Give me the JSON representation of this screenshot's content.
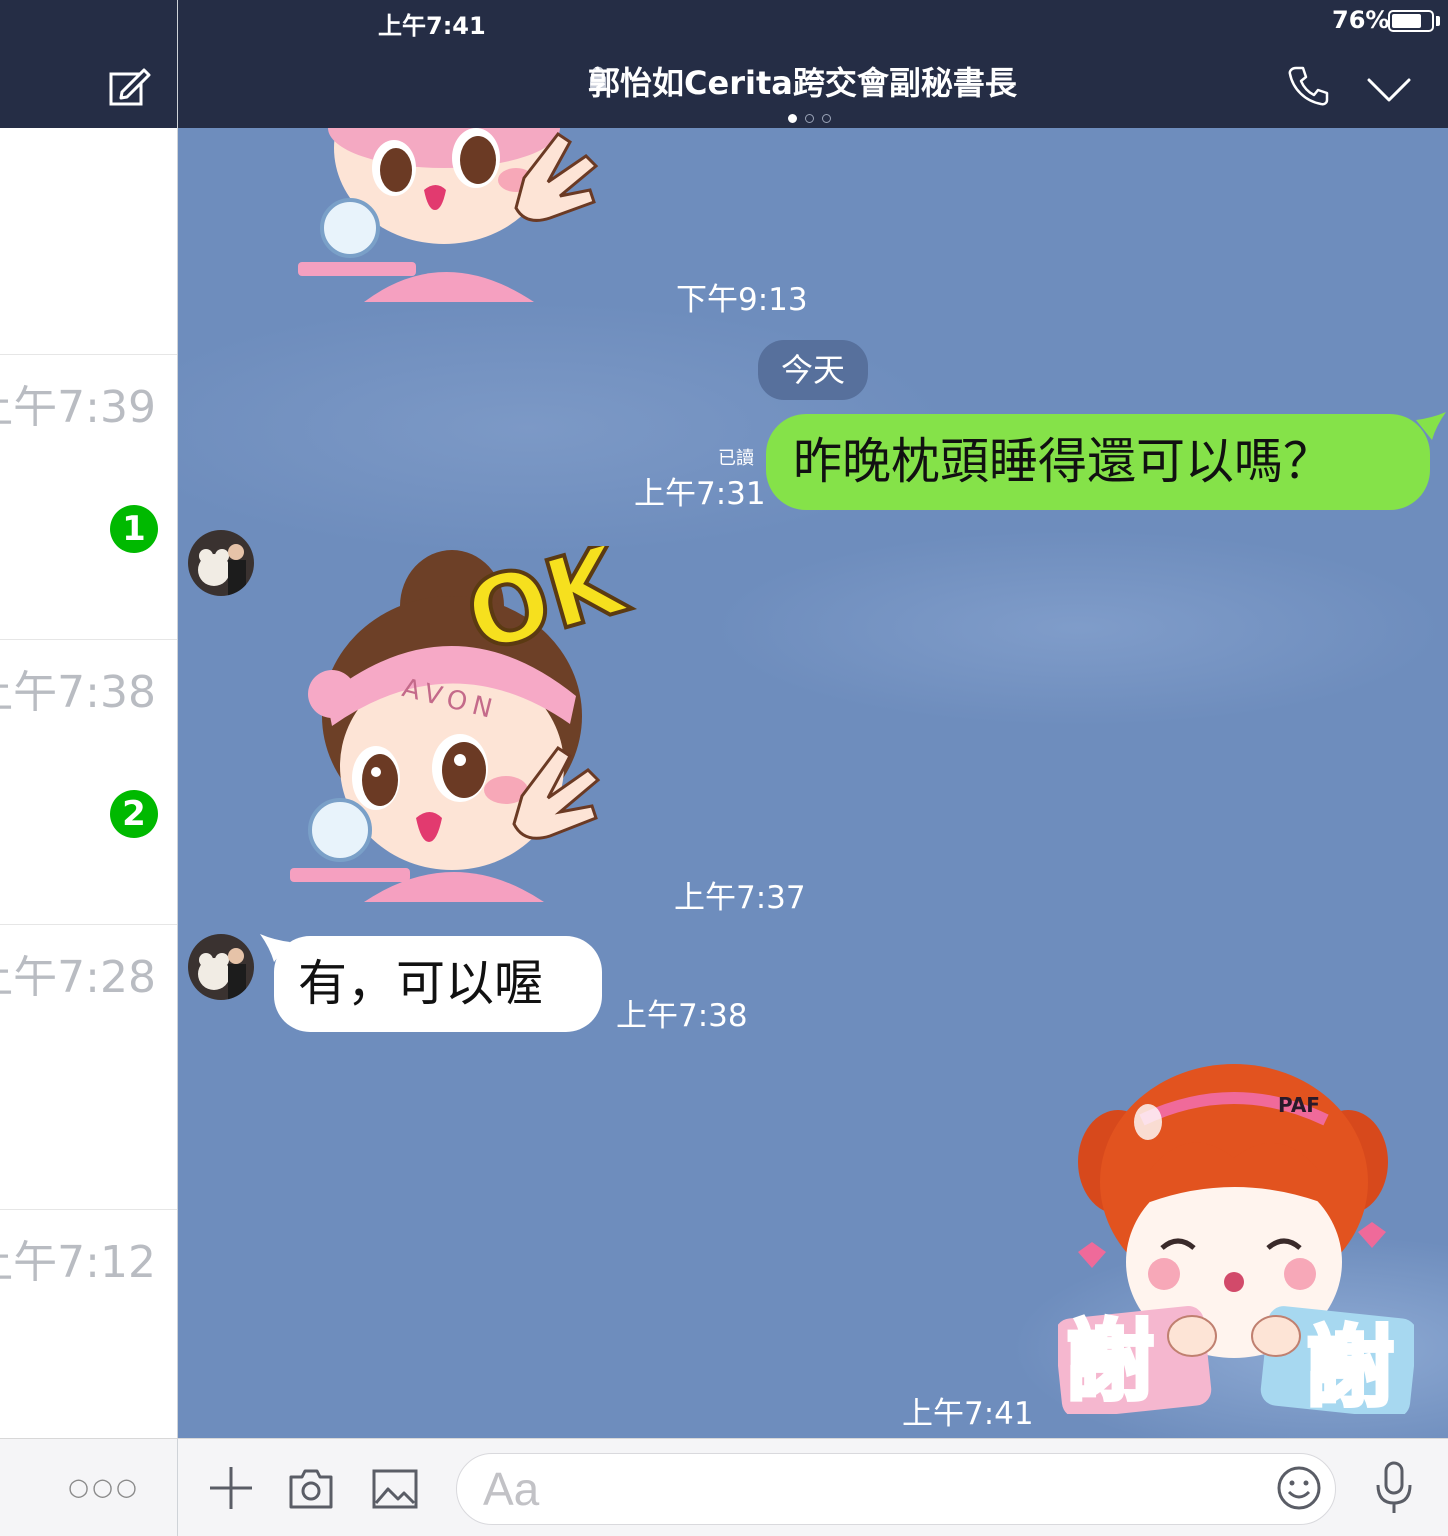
{
  "status_bar": {
    "time": "上午7:41",
    "battery": "76%",
    "battery_level": 0.76
  },
  "header": {
    "title": "郭怡如Cerita跨交會副秘書長"
  },
  "chat_list": [
    {
      "time": "上午7:39",
      "unread": "1"
    },
    {
      "time": "上午7:38",
      "unread": "2"
    },
    {
      "time": "上午7:28"
    },
    {
      "time": "上午7:12"
    }
  ],
  "messages": {
    "first_sticker_time": "下午9:13",
    "date_separator": "今天",
    "outgoing": {
      "text": "昨晚枕頭睡得還可以嗎？",
      "time": "上午7:31",
      "read": "已讀"
    },
    "ok_sticker": {
      "text": "OK",
      "headband": "AVON",
      "time": "上午7:37"
    },
    "incoming": {
      "text": "有，可以喔",
      "time": "上午7:38"
    },
    "thanks_sticker": {
      "text_left": "謝",
      "text_right": "謝",
      "badge": "PAF",
      "time": "上午7:41"
    }
  },
  "input": {
    "placeholder": "Aa"
  },
  "colors": {
    "header_bg": "#252d45",
    "chat_bg": "#6e8dbd",
    "outgoing_bubble": "#85e249",
    "badge": "#00b900"
  }
}
